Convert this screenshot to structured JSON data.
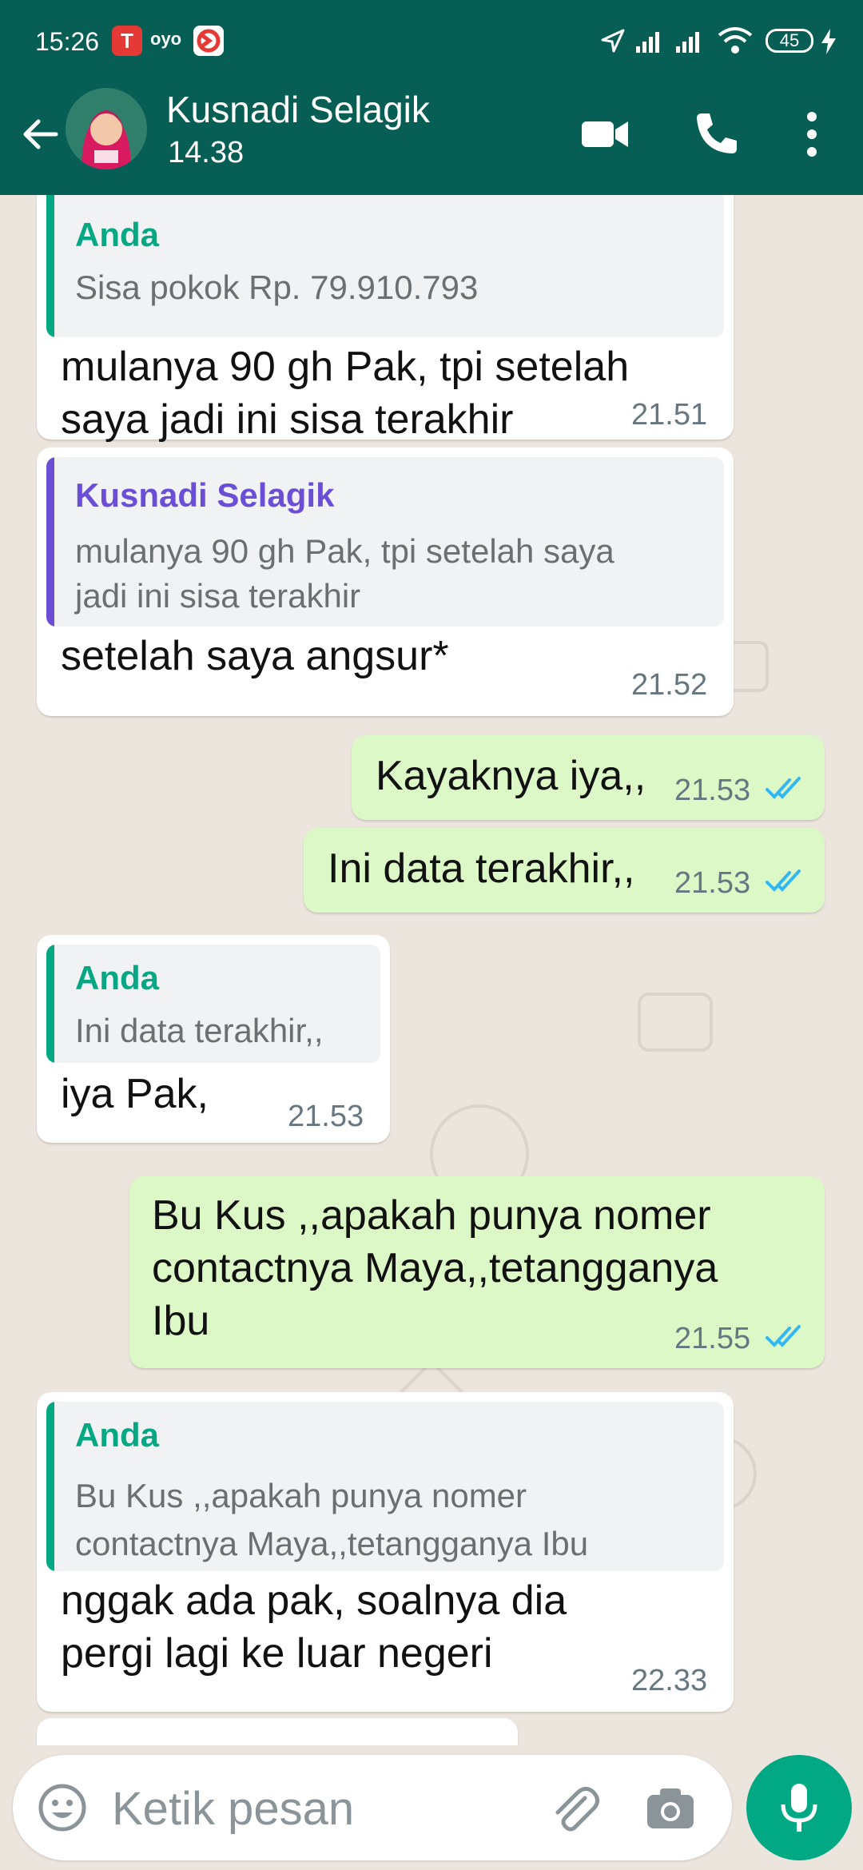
{
  "status_bar": {
    "time": "15:26",
    "battery": "45",
    "app_icon_labels": [
      "T",
      "oyo"
    ]
  },
  "header": {
    "contact_name": "Kusnadi Selagik",
    "subtitle": "14.38"
  },
  "messages": [
    {
      "id": "m1",
      "direction": "in",
      "quote_author": "Anda",
      "quote_text": "Sisa pokok  Rp. 79.910.793",
      "text": "mulanya 90 gh Pak, tpi setelah\nsaya jadi ini sisa terakhir",
      "time": "21.51"
    },
    {
      "id": "m2",
      "direction": "in",
      "quote_author": "Kusnadi Selagik",
      "quote_text": "mulanya 90 gh Pak, tpi setelah saya\njadi ini sisa terakhir",
      "text": "setelah saya angsur*",
      "time": "21.52"
    },
    {
      "id": "m3",
      "direction": "out",
      "text": "Kayaknya iya,,",
      "time": "21.53",
      "read": true
    },
    {
      "id": "m4",
      "direction": "out",
      "text": "Ini data terakhir,,",
      "time": "21.53",
      "read": true
    },
    {
      "id": "m5",
      "direction": "in",
      "quote_author": "Anda",
      "quote_text": "Ini data terakhir,,",
      "text": "iya Pak,",
      "time": "21.53"
    },
    {
      "id": "m6",
      "direction": "out",
      "text": "Bu Kus ,,apakah punya nomer\ncontactnya Maya,,tetangganya\nIbu",
      "time": "21.55",
      "read": true
    },
    {
      "id": "m7",
      "direction": "in",
      "quote_author": "Anda",
      "quote_text": "Bu Kus ,,apakah punya nomer\ncontactnya Maya,,tetangganya Ibu",
      "text": "nggak ada pak, soalnya dia\npergi lagi ke luar negeri",
      "time": "22.33"
    }
  ],
  "input": {
    "placeholder": "Ketik pesan"
  },
  "colors": {
    "header": "#075e54",
    "outgoing_bubble": "#dcf8c6",
    "incoming_bubble": "#ffffff",
    "chat_bg": "#ece5dd",
    "quote_self": "#06a884",
    "quote_other": "#6a4fd6",
    "read_ticks": "#34b7f1",
    "mic_button": "#00a884"
  },
  "icons": [
    "back-arrow-icon",
    "video-call-icon",
    "voice-call-icon",
    "more-options-icon",
    "emoji-icon",
    "attach-icon",
    "camera-icon",
    "mic-icon"
  ]
}
